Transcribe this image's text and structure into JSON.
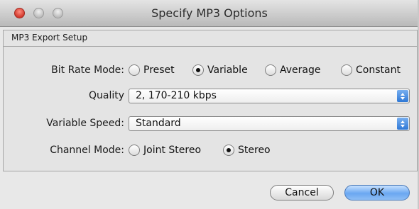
{
  "window": {
    "title": "Specify MP3 Options"
  },
  "section": {
    "label": "MP3 Export Setup"
  },
  "bit_rate_mode": {
    "label": "Bit Rate Mode:",
    "options": [
      "Preset",
      "Variable",
      "Average",
      "Constant"
    ],
    "selected": "Variable"
  },
  "quality": {
    "label": "Quality",
    "value": "2, 170-210 kbps"
  },
  "variable_speed": {
    "label": "Variable Speed:",
    "value": "Standard"
  },
  "channel_mode": {
    "label": "Channel Mode:",
    "options": [
      "Joint Stereo",
      "Stereo"
    ],
    "selected": "Stereo"
  },
  "buttons": {
    "cancel": "Cancel",
    "ok": "OK"
  },
  "colors": {
    "close_button": "#d2392d",
    "default_button": "#6aa7f1",
    "popup_arrow": "#2f78d6"
  }
}
